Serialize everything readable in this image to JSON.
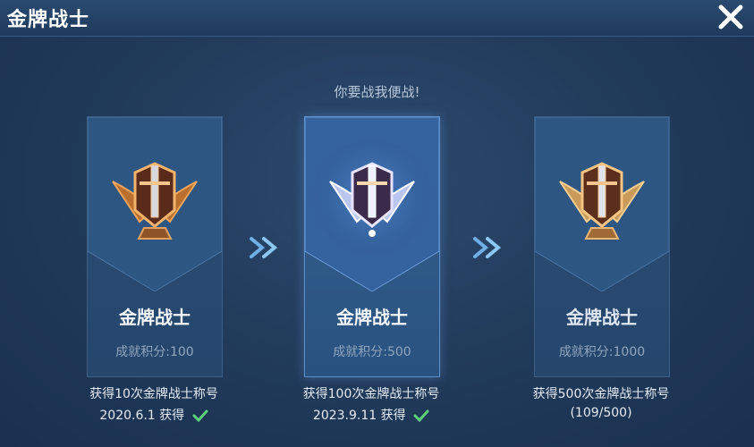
{
  "header": {
    "title": "金牌战士"
  },
  "subtitle": "你要战我便战!",
  "cards": [
    {
      "title": "金牌战士",
      "score": "成就积分:100",
      "desc_line1": "获得10次金牌战士称号",
      "desc_date": "2020.6.1",
      "desc_status": "获得",
      "badge_tier": "bronze"
    },
    {
      "title": "金牌战士",
      "score": "成就积分:500",
      "desc_line1": "获得100次金牌战士称号",
      "desc_date": "2023.9.11",
      "desc_status": "获得",
      "badge_tier": "silver"
    },
    {
      "title": "金牌战士",
      "score": "成就积分:1000",
      "desc_line1": "获得500次金牌战士称号",
      "desc_progress": "(109/500)",
      "badge_tier": "gold"
    }
  ],
  "icons": {
    "close": "close-icon",
    "arrow": "double-chevron-right-icon",
    "check": "check-icon"
  },
  "colors": {
    "accent_check": "#5fd17a",
    "background": "#223c5c"
  }
}
